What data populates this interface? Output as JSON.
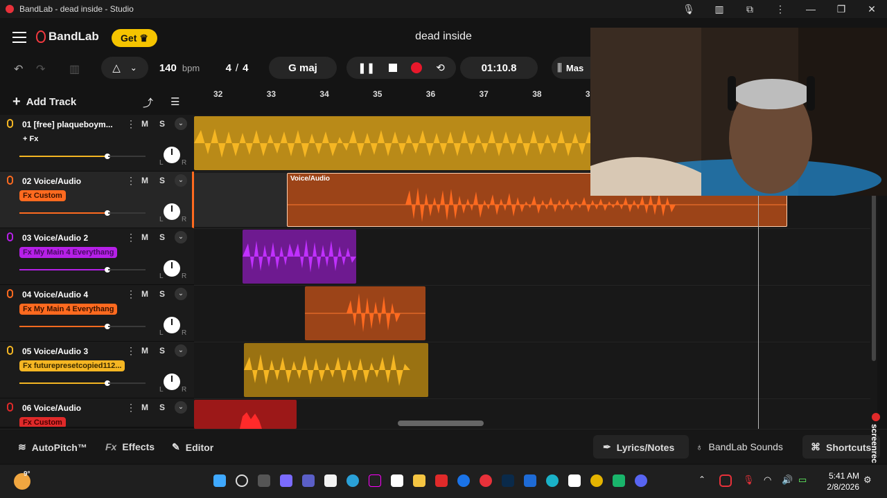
{
  "window": {
    "title": "BandLab - dead inside - Studio"
  },
  "header": {
    "brand": "BandLab",
    "get_label": "Get",
    "song_title": "dead inside"
  },
  "transport": {
    "bpm_value": "140",
    "bpm_unit": "bpm",
    "ts_num": "4",
    "ts_sep": "/",
    "ts_den": "4",
    "key": "G maj",
    "time": "01:10.8",
    "mixer_label": "Mas"
  },
  "tracks_panel": {
    "add_track_label": "Add Track"
  },
  "ruler": {
    "bars": [
      "32",
      "33",
      "34",
      "35",
      "36",
      "37",
      "38",
      "3"
    ]
  },
  "tracks": [
    {
      "name": "01  [free] plaqueboym...",
      "fx": "+ Fx",
      "color": "#f5b623",
      "fx_bg": "transparent",
      "fx_color": "#fff",
      "mic": "#f5b623",
      "vol": 0.7
    },
    {
      "name": "02  Voice/Audio",
      "fx": "Fx Custom",
      "color": "#ff6a1f",
      "fx_bg": "#ff6a1f",
      "fx_color": "#3a1400",
      "mic": "#ff6a1f",
      "vol": 0.7
    },
    {
      "name": "03  Voice/Audio 2",
      "fx": "Fx My Main 4 Everythang",
      "color": "#b620e8",
      "fx_bg": "#b620e8",
      "fx_color": "#4a0a66",
      "mic": "#b620e8",
      "vol": 0.7
    },
    {
      "name": "04  Voice/Audio 4",
      "fx": "Fx My Main 4 Everythang",
      "color": "#ff6a1f",
      "fx_bg": "#ff6a1f",
      "fx_color": "#3a1400",
      "mic": "#ff6a1f",
      "vol": 0.7
    },
    {
      "name": "05  Voice/Audio 3",
      "fx": "Fx futurepresetcopied112...",
      "color": "#f5b623",
      "fx_bg": "#f5b623",
      "fx_color": "#3a2a00",
      "mic": "#f5b623",
      "vol": 0.7
    },
    {
      "name": "06  Voice/Audio",
      "fx": "Fx Custom",
      "color": "#e02a2a",
      "fx_bg": "#e02a2a",
      "fx_color": "#4a0000",
      "mic": "#e02a2a",
      "vol": 0.7
    }
  ],
  "clips": {
    "voice_audio_label": "Voice/Audio"
  },
  "bottom": {
    "autopitch": "AutoPitch™",
    "effects_prefix": "Fx",
    "effects": "Effects",
    "editor": "Editor",
    "lyrics": "Lyrics/Notes",
    "sounds": "BandLab Sounds",
    "shortcuts": "Shortcuts",
    "screenrec": "screenrec"
  },
  "taskbar": {
    "temp": "9°",
    "time": "5:41 AM",
    "date": "2/8/2026"
  }
}
